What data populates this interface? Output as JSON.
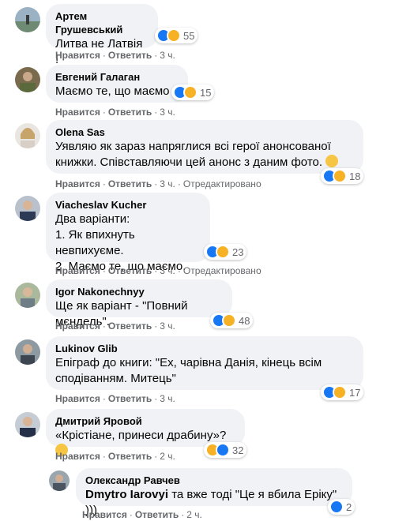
{
  "actions": {
    "like": "Нравится",
    "reply": "Ответить",
    "edited": "Отредактировано",
    "sep": "·"
  },
  "comments": [
    {
      "author": "Артем Грушевський",
      "text": "Литва не Латвія !",
      "reactions": "55",
      "time": "3 ч."
    },
    {
      "author": "Евгений Галаган",
      "text": "Маємо те, що маємо",
      "reactions": "15",
      "time": "3 ч."
    },
    {
      "author": "Olena Sas",
      "text_line1": "Уявляю як зараз напряглися всі герої анонсованої",
      "text_line2": "книжки. Співставляючи цей анонс з даним фото.",
      "reactions": "18",
      "time": "3 ч."
    },
    {
      "author": "Viacheslav Kucher",
      "text_line1": "Два варіанти:",
      "text_line2": "1. Як впихнуть невпихуєме.",
      "text_line3": "2. Маємо те, що маємо.",
      "reactions": "23",
      "time": "3 ч."
    },
    {
      "author": "Igor Nakonechnyy",
      "text": "Ще як варіант - \"Повний мєндель\".",
      "reactions": "48",
      "time": "3 ч."
    },
    {
      "author": "Lukinov Glib",
      "text_line1": "Епіграф до книги: \"Ех, чарівна Данія, кінець всім",
      "text_line2": "сподіванням. Митець\"",
      "reactions": "17",
      "time": "3 ч."
    },
    {
      "author": "Дмитрий Яровой",
      "text": "«Крістіане, принеси драбину»?",
      "reactions": "32",
      "time": "2 ч."
    },
    {
      "author": "Олександр Равчев",
      "mention": "Dmytro Iarovyi",
      "text": " та вже тоді \"Це я вбила Еріку\" )))",
      "reactions": "2",
      "time": "2 ч."
    }
  ],
  "colors": {
    "bubble": "#f0f2f5",
    "like": "#1877f2",
    "haha": "#f7b125",
    "meta": "#65676b"
  }
}
